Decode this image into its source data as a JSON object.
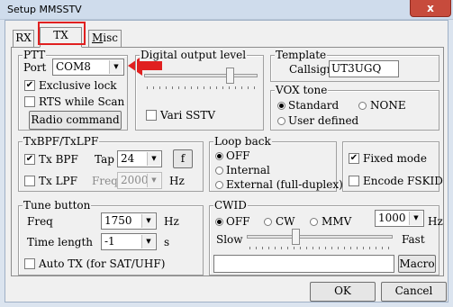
{
  "window": {
    "title": "Setup MMSSTV",
    "close_glyph": "x"
  },
  "tabs": [
    {
      "label": "RX"
    },
    {
      "label": "TX"
    },
    {
      "label": "Misc",
      "mnemonic": "M",
      "rest": "isc"
    }
  ],
  "ptt": {
    "legend": "PTT",
    "port_label": "Port",
    "port_value": "COM8",
    "exclusive_lock_label": "Exclusive lock",
    "rts_scan_label": "RTS while Scan",
    "radio_command_label": "Radio command"
  },
  "digital_output": {
    "legend": "Digital output level",
    "vari_sstv_label": "Vari SSTV",
    "level": 0.78
  },
  "template": {
    "legend": "Template",
    "callsign_label": "Callsign",
    "callsign_value": "UT3UGQ"
  },
  "vox": {
    "legend": "VOX tone",
    "standard_label": "Standard",
    "none_label": "NONE",
    "user_defined_label": "User defined"
  },
  "txbpf": {
    "legend": "TxBPF/TxLPF",
    "tx_bpf_label": "Tx BPF",
    "tap_label": "Tap",
    "tap_value": "24",
    "f_button_label": "f",
    "tx_lpf_label": "Tx LPF",
    "freq_label": "Freq",
    "freq_value": "2000",
    "hz_label": "Hz"
  },
  "loopback": {
    "legend": "Loop back",
    "off_label": "OFF",
    "internal_label": "Internal",
    "external_label": "External (full-duplex)"
  },
  "modes": {
    "fixed_mode_label": "Fixed mode",
    "encode_fskid_label": "Encode FSKID"
  },
  "tune": {
    "legend": "Tune button",
    "freq_label": "Freq",
    "freq_value": "1750",
    "hz_label": "Hz",
    "time_length_label": "Time length",
    "time_length_value": "-1",
    "s_label": "s",
    "auto_tx_label": "Auto TX (for SAT/UHF)"
  },
  "cwid": {
    "legend": "CWID",
    "off_label": "OFF",
    "cw_label": "CW",
    "mmv_label": "MMV",
    "speed_value": "1000",
    "hz_label": "Hz",
    "slow_label": "Slow",
    "fast_label": "Fast",
    "speed_level": 0.33,
    "text_value": "",
    "macro_label": "Macro"
  },
  "footer": {
    "ok_label": "OK",
    "cancel_label": "Cancel"
  },
  "colors": {
    "annotation": "#e02020",
    "close": "#c74b3c"
  }
}
